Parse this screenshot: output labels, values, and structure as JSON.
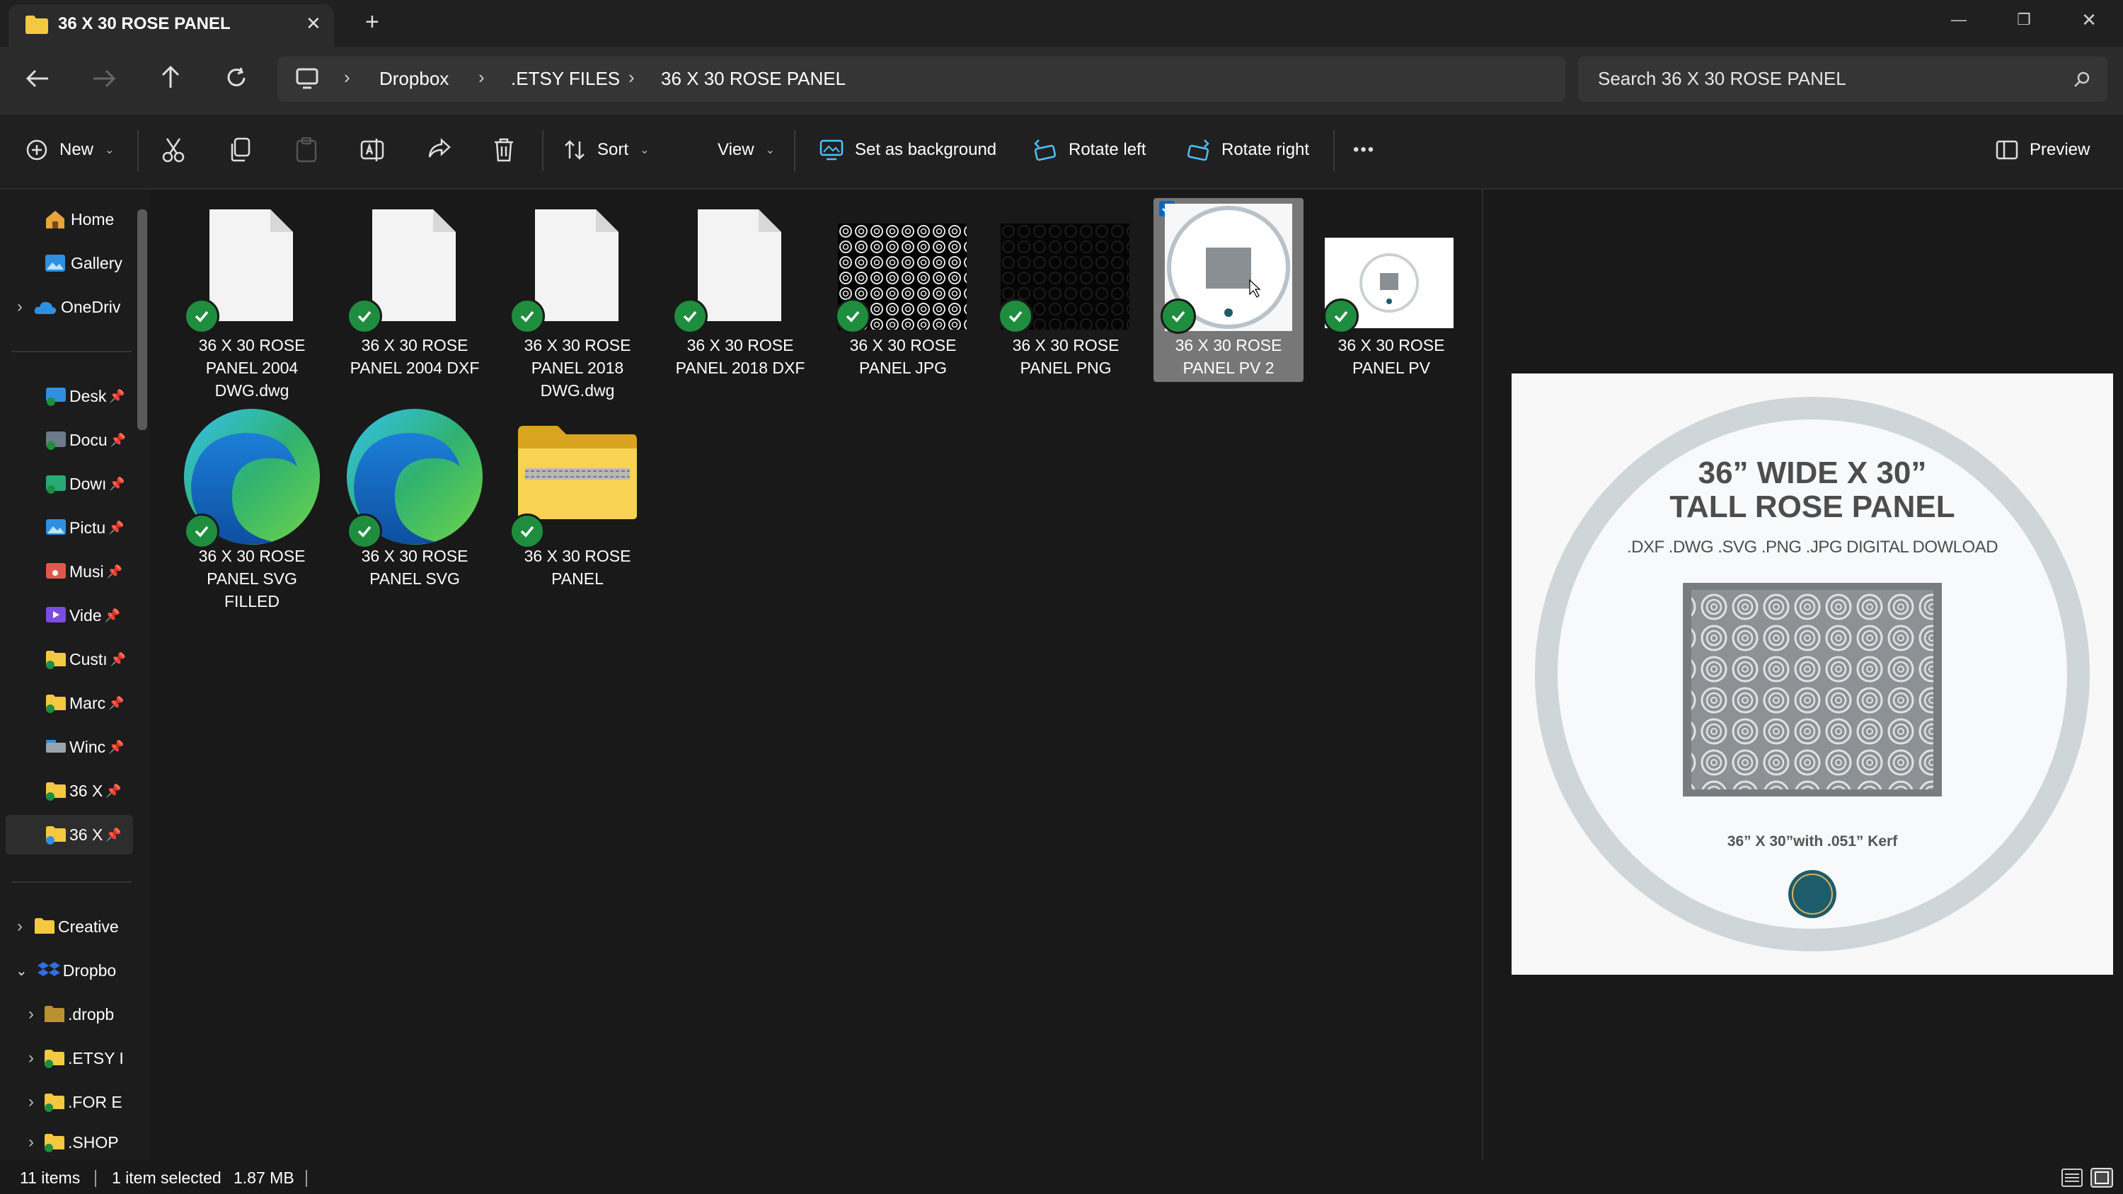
{
  "window": {
    "tab_title": "36 X 30 ROSE PANEL",
    "new_tab": "+",
    "minimize": "—",
    "maximize": "❐",
    "close": "✕"
  },
  "address": {
    "breadcrumbs": [
      "Dropbox",
      ".ETSY FILES",
      "36 X 30 ROSE PANEL"
    ],
    "separator": "›",
    "search_placeholder": "Search 36 X 30 ROSE PANEL"
  },
  "toolbar": {
    "new_label": "New",
    "sort_label": "Sort",
    "view_label": "View",
    "set_background_label": "Set as background",
    "rotate_left_label": "Rotate left",
    "rotate_right_label": "Rotate right",
    "more_label": "•••",
    "preview_label": "Preview"
  },
  "nav": {
    "home": "Home",
    "gallery": "Gallery",
    "onedrive": "OneDriv",
    "pinned": [
      "Desk",
      "Docu",
      "Dowı",
      "Pictu",
      "Musi",
      "Vide",
      "Custı",
      "Marc",
      "Winc",
      "36 X",
      "36 X"
    ],
    "creative": "Creative",
    "dropbox": "Dropbo",
    "dropbox_children": [
      ".dropb",
      ".ETSY I",
      ".FOR E",
      ".SHOP"
    ]
  },
  "files": [
    {
      "l1": "36 X 30 ROSE",
      "l2": "PANEL 2004",
      "l3": "DWG.dwg",
      "icon": "document-icon"
    },
    {
      "l1": "36 X 30 ROSE",
      "l2": "PANEL 2004 DXF",
      "l3": "",
      "icon": "document-icon"
    },
    {
      "l1": "36 X 30 ROSE",
      "l2": "PANEL 2018",
      "l3": "DWG.dwg",
      "icon": "document-icon"
    },
    {
      "l1": "36 X 30 ROSE",
      "l2": "PANEL 2018 DXF",
      "l3": "",
      "icon": "document-icon"
    },
    {
      "l1": "36 X 30 ROSE",
      "l2": "PANEL JPG",
      "l3": "",
      "icon": "pattern-thumbnail"
    },
    {
      "l1": "36 X 30 ROSE",
      "l2": "PANEL PNG",
      "l3": "",
      "icon": "dark-pattern-thumbnail"
    },
    {
      "l1": "36 X 30 ROSE",
      "l2": "PANEL PV 2",
      "l3": "",
      "icon": "preview-thumbnail"
    },
    {
      "l1": "36 X 30 ROSE",
      "l2": "PANEL PV",
      "l3": "",
      "icon": "preview-thumbnail"
    },
    {
      "l1": "36 X 30 ROSE",
      "l2": "PANEL SVG",
      "l3": "FILLED",
      "icon": "edge-icon"
    },
    {
      "l1": "36 X 30 ROSE",
      "l2": "PANEL SVG",
      "l3": "",
      "icon": "edge-icon"
    },
    {
      "l1": "36 X 30 ROSE",
      "l2": "PANEL",
      "l3": "",
      "icon": "zip-folder-icon"
    }
  ],
  "preview": {
    "title1": "36” WIDE X 30”",
    "title2": "TALL  ROSE PANEL",
    "formats": ".DXF .DWG .SVG .PNG .JPG DIGITAL DOWLOAD",
    "size_note": "36” X 30”with .051” Kerf"
  },
  "status": {
    "items": "11 items",
    "selected": "1 item selected",
    "size": "1.87 MB"
  },
  "colors": {
    "accent": "#0067c0",
    "sync_green": "#1e8e3e",
    "folder_yellow": "#f5c842"
  }
}
